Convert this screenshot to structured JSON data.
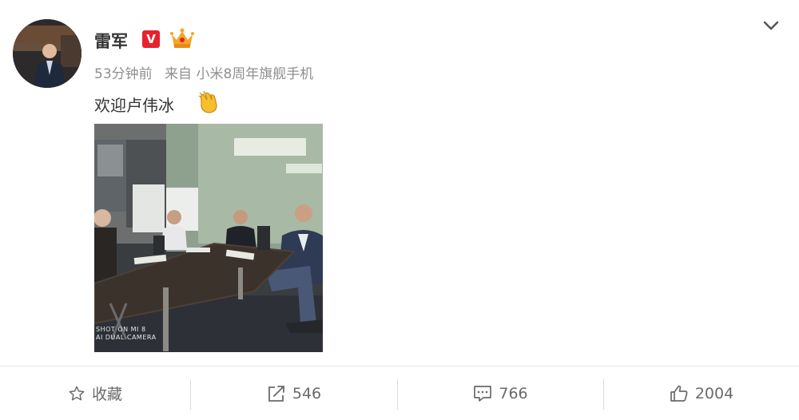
{
  "post": {
    "author": "雷军",
    "verified_badge": "V",
    "time": "53分钟前",
    "source": "来自 小米8周年旗舰手机",
    "text": "欢迎卢伟冰",
    "photo_watermark_line1": "SHOT ON MI 8",
    "photo_watermark_line2": "AI DUAL CAMERA"
  },
  "actions": {
    "favorite_label": "收藏",
    "share_count": "546",
    "comment_count": "766",
    "like_count": "2004"
  },
  "colors": {
    "verified": "#e5232d",
    "crown": "#f5a623",
    "meta_text": "#8f8f8f",
    "action_text": "#6a6a6a"
  },
  "icons": [
    "chevron-down-icon",
    "crown-icon",
    "clapping-hands-icon",
    "star-icon",
    "share-icon",
    "comment-icon",
    "thumbs-up-icon"
  ]
}
